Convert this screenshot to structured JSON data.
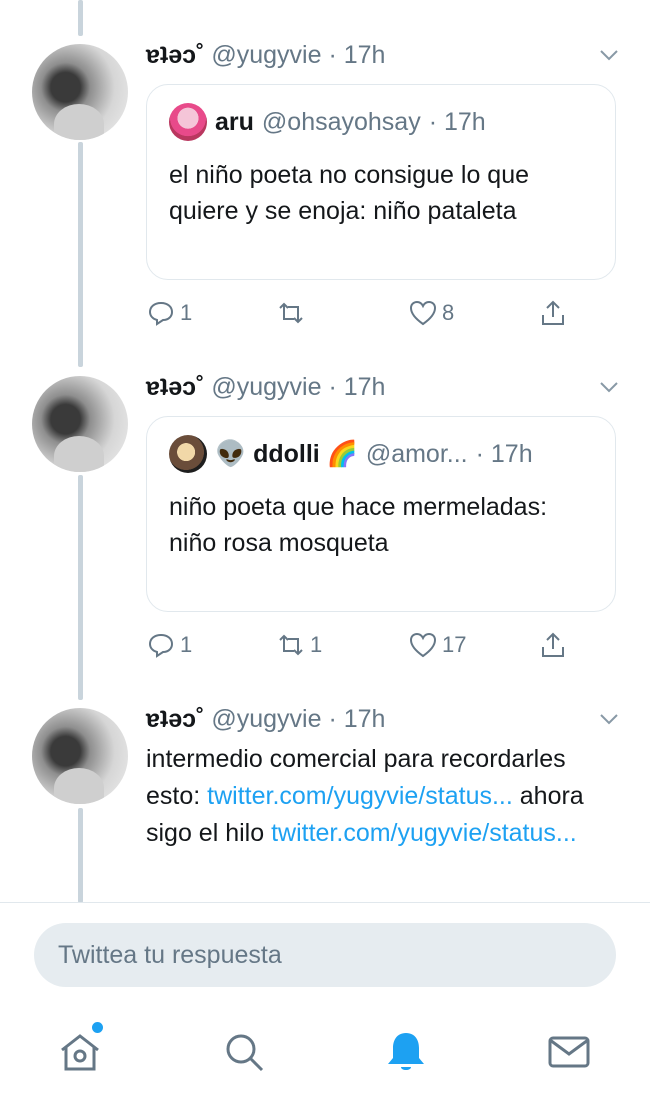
{
  "thread": [
    {
      "display_name": "ɐʇǝɔ˚",
      "handle": "@yugyvie",
      "time": "· 17h",
      "quote": {
        "name": "aru",
        "handle": "@ohsayohsay",
        "time": "· 17h",
        "text": "el niño poeta no consigue lo que quiere y se enoja: niño pataleta"
      },
      "replies": "1",
      "retweets": "",
      "likes": "8"
    },
    {
      "display_name": "ɐʇǝɔ˚",
      "handle": "@yugyvie",
      "time": "· 17h",
      "quote": {
        "name": "👽 ddolli 🌈",
        "handle": "@amor...",
        "time": "· 17h",
        "text": "niño poeta que hace mermeladas: niño rosa mosqueta"
      },
      "replies": "1",
      "retweets": "1",
      "likes": "17"
    },
    {
      "display_name": "ɐʇǝɔ˚",
      "handle": "@yugyvie",
      "time": "· 17h",
      "text_part1": "intermedio comercial para recordarles esto: ",
      "link1": "twitter.com/yugyvie/status...",
      "text_part2": " ahora sigo el hilo ",
      "link2": "twitter.com/yugyvie/status..."
    }
  ],
  "reply_placeholder": "Twittea tu respuesta",
  "colors": {
    "accent": "#1da1f2",
    "muted": "#657786",
    "line": "#c9d4dc"
  },
  "icons": [
    "home-icon",
    "search-icon",
    "notifications-icon",
    "messages-icon"
  ]
}
